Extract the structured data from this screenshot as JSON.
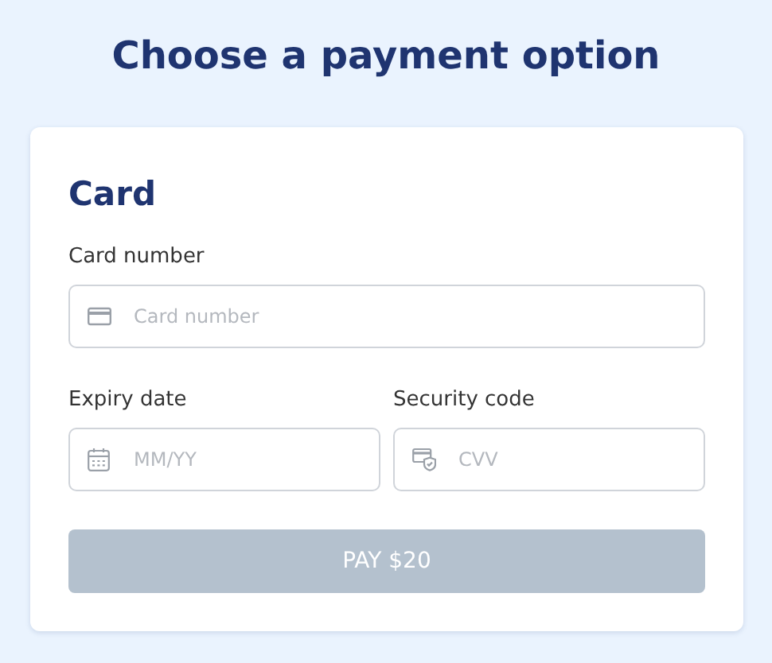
{
  "title": "Choose a payment option",
  "card": {
    "heading": "Card",
    "fields": [
      {
        "label": "Card number",
        "placeholder": "Card number",
        "kind": "card"
      },
      {
        "label": "Expiry date",
        "placeholder": "MM/YY",
        "kind": "date"
      },
      {
        "label": "Security code",
        "placeholder": "CVV",
        "kind": "cvv"
      }
    ],
    "pay_button": {
      "label": "PAY $20",
      "disabled": true
    }
  }
}
